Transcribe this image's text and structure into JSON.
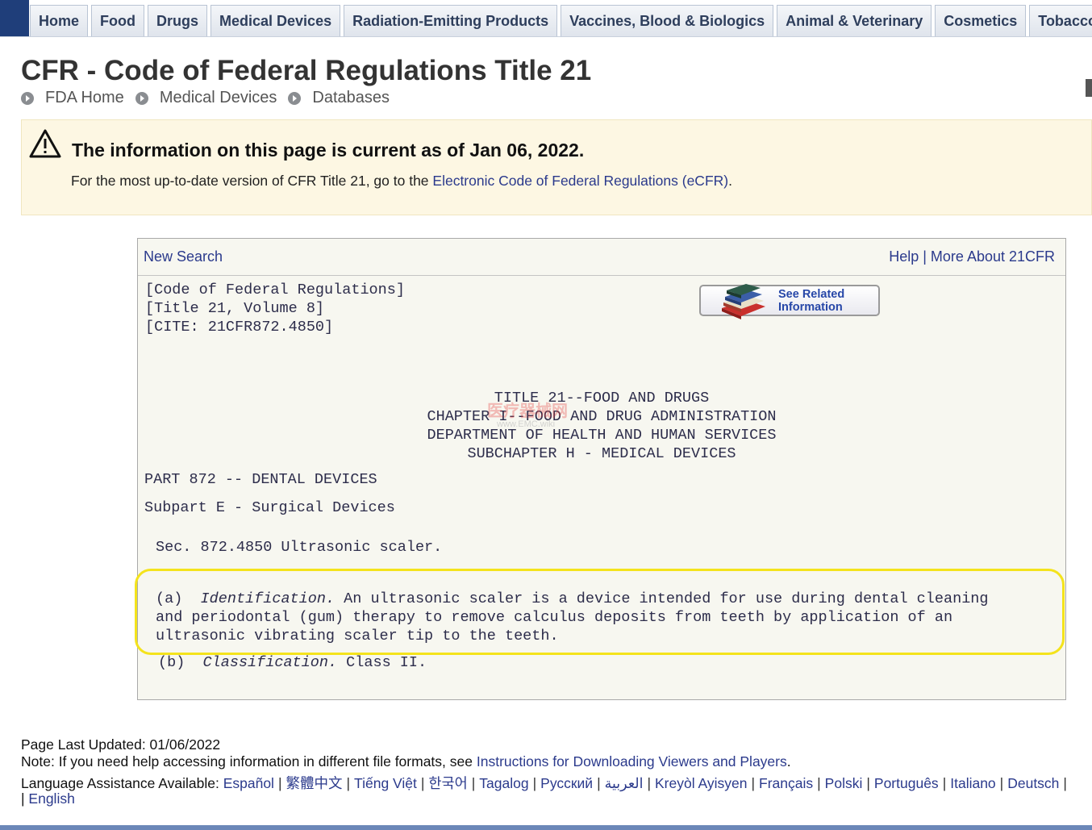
{
  "nav": {
    "tabs": [
      "Home",
      "Food",
      "Drugs",
      "Medical Devices",
      "Radiation-Emitting Products",
      "Vaccines, Blood & Biologics",
      "Animal & Veterinary",
      "Cosmetics",
      "Tobacco"
    ]
  },
  "page": {
    "title": "CFR - Code of Federal Regulations Title 21",
    "breadcrumb": [
      "FDA Home",
      "Medical Devices",
      "Databases"
    ]
  },
  "alert": {
    "icon": "warning-triangle-icon",
    "title": "The information on this page is current as of Jan 06, 2022.",
    "text_prefix": "For the most up-to-date version of CFR Title 21, go to the ",
    "link": "Electronic Code of Federal Regulations (eCFR)",
    "text_suffix": "."
  },
  "panel": {
    "new_search": "New Search",
    "help": "Help",
    "divider": " | ",
    "more_about": "More About 21CFR",
    "cite_lines": [
      "[Code of Federal Regulations]",
      "[Title 21, Volume 8]",
      "[CITE: 21CFR872.4850]"
    ],
    "related_button": {
      "line1": "See Related",
      "line2": "Information",
      "icon": "books-icon"
    },
    "headings": [
      "TITLE 21--FOOD AND DRUGS",
      "CHAPTER I--FOOD AND DRUG ADMINISTRATION",
      "DEPARTMENT OF HEALTH AND HUMAN SERVICES",
      "SUBCHAPTER H - MEDICAL DEVICES"
    ],
    "part": "PART 872 -- DENTAL DEVICES",
    "subpart": "Subpart E - Surgical Devices",
    "section": "Sec. 872.4850 Ultrasonic scaler.",
    "para_a": {
      "label": "(a)",
      "term": "Identification.",
      "line1": " An ultrasonic scaler is a device intended for use during dental cleaning",
      "line2": "and periodontal (gum) therapy to remove calculus deposits from teeth by application of an",
      "line3": "ultrasonic vibrating scaler tip to the teeth."
    },
    "para_b": {
      "label": "(b)",
      "term": "Classification.",
      "text": " Class II."
    },
    "highlight_color": "#f4e31c"
  },
  "watermark": {
    "main": "医疗器械网",
    "sub": "www.EMC.wiki"
  },
  "footer": {
    "updated": "Page Last Updated: 01/06/2022",
    "note_prefix": "Note: If you need help accessing information in different file formats, see ",
    "note_link": "Instructions for Downloading Viewers and Players",
    "note_suffix": ".",
    "lang_prefix": "Language Assistance Available: ",
    "languages": [
      "Español",
      "繁體中文",
      "Tiếng Việt",
      "한국어",
      "Tagalog",
      "Русский",
      "العربية",
      "Kreyòl Ayisyen",
      "Français",
      "Polski",
      "Português",
      "Italiano",
      "Deutsch"
    ],
    "lang_tail": "|",
    "lang_line2_prefix": "| ",
    "english": "English"
  },
  "colors": {
    "link": "#2b3a8c",
    "nav_accent": "#1f3e7a",
    "alert_bg": "#fdf7e3",
    "panel_bg": "#f7f7f0"
  }
}
